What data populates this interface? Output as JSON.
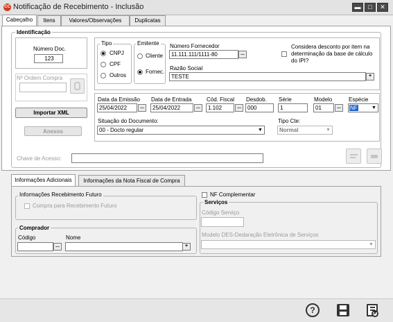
{
  "window": {
    "title": "Notificação de Recebimento - Inclusão",
    "icon": "app-logo-icon",
    "icon_text": "CC"
  },
  "tabs": [
    "Cabeçalho",
    "Itens",
    "Valores/Observações",
    "Duplicatas"
  ],
  "identificacao": {
    "title": "Identificação",
    "numero_doc": {
      "label": "Número Doc.",
      "value": "123"
    },
    "ordem_compra": {
      "label": "Nº Ordem Compra",
      "value": ""
    },
    "importar_xml": "Importar XML",
    "anexos": "Anexos",
    "tipo": {
      "label": "Tipo",
      "options": [
        "CNPJ",
        "CPF",
        "Outros"
      ],
      "selected": "CNPJ"
    },
    "emitente": {
      "label": "Emitente",
      "options": [
        "Cliente",
        "Fornec."
      ],
      "selected": "Fornec."
    },
    "numero_fornecedor": {
      "label": "Número Fornecedor",
      "value": "11.111.111/1111-80"
    },
    "razao_social": {
      "label": "Razão Social",
      "value": "TESTE"
    },
    "considera_desconto": {
      "label": "Considera desconto por item na determinação da base de cálculo do IPI?",
      "checked": false
    },
    "data_emissao": {
      "label": "Data da Emissão",
      "value": "25/04/2022"
    },
    "data_entrada": {
      "label": "Data de Entrada",
      "value": "25/04/2022"
    },
    "cod_fiscal": {
      "label": "Cód. Fiscal",
      "value": "1.102"
    },
    "desdob": {
      "label": "Desdob.",
      "value": "000"
    },
    "serie": {
      "label": "Série",
      "value": "1"
    },
    "modelo": {
      "label": "Modelo",
      "value": "01"
    },
    "especie": {
      "label": "Espécie",
      "value": "NF"
    },
    "situacao": {
      "label": "Situação do Documento:",
      "value": "00 - Docto regular"
    },
    "tipo_cte": {
      "label": "Tipo Cte:",
      "value": "Normal"
    },
    "chave_acesso": {
      "label": "Chave de Acesso:",
      "value": ""
    }
  },
  "lower_tabs": [
    "Informações Adicionais",
    "Informações da Nota Fiscal de Compra"
  ],
  "recebimento_futuro": {
    "title": "Informações Recebimento Futuro",
    "checkbox_label": "Compra para Recebimento Futuro"
  },
  "nf_complementar": {
    "label": "NF Complementar",
    "checked": false
  },
  "servicos": {
    "title": "Serviços",
    "codigo_label": "Código Serviço",
    "modelo_label": "Modelo DES-Dedaração Eletrônica de Serviços",
    "codigo_value": "",
    "modelo_value": ""
  },
  "comprador": {
    "title": "Comprador",
    "codigo_label": "Código",
    "nome_label": "Nome",
    "codigo_value": "",
    "nome_value": ""
  },
  "glyphs": {
    "ellipsis": "...",
    "plus": "+",
    "dropdown": "▼",
    "minimize": "▬",
    "maximize": "□",
    "close": "✕",
    "help": "?",
    "save": "💾",
    "cancel": "✗"
  },
  "colors": {
    "accent_selection": "#1e62d0",
    "app_icon": "#d23a1e"
  }
}
